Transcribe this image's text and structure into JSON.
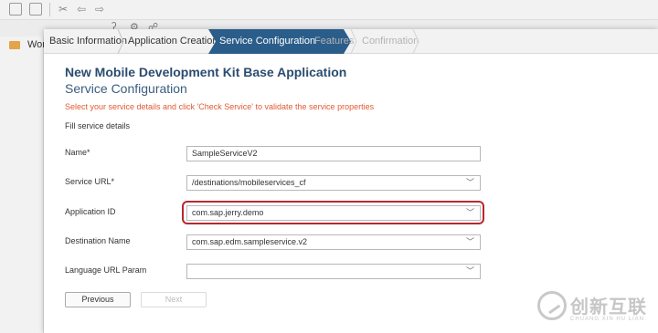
{
  "ide": {
    "side_label": "Wor"
  },
  "wizard": {
    "steps": [
      {
        "label": "Basic Information",
        "state": "done"
      },
      {
        "label": "Application Creation",
        "state": "done"
      },
      {
        "label": "Service Configuration",
        "state": "active"
      },
      {
        "label": "Features",
        "state": "upcoming"
      },
      {
        "label": "Confirmation",
        "state": "upcoming"
      }
    ],
    "title": "New Mobile Development Kit Base Application",
    "subtitle": "Service Configuration",
    "hint": "Select your service details and click 'Check Service' to validate the service properties",
    "section": "Fill service details",
    "fields": {
      "name": {
        "label": "Name*",
        "value": "SampleServiceV2"
      },
      "service_url": {
        "label": "Service URL*",
        "value": "/destinations/mobileservices_cf"
      },
      "application_id": {
        "label": "Application ID",
        "value": "com.sap.jerry.demo"
      },
      "destination_name": {
        "label": "Destination Name",
        "value": "com.sap.edm.sampleservice.v2"
      },
      "language_url_param": {
        "label": "Language URL Param",
        "value": ""
      }
    },
    "buttons": {
      "previous": "Previous",
      "next": "Next"
    },
    "colors": {
      "active_step": "#2a5d8a",
      "title": "#2b4c6f",
      "hint": "#e25a32",
      "highlight": "#b8282e"
    }
  },
  "watermark": {
    "cn": "创新互联",
    "en": "CHUANG XIN HU LIAN"
  }
}
